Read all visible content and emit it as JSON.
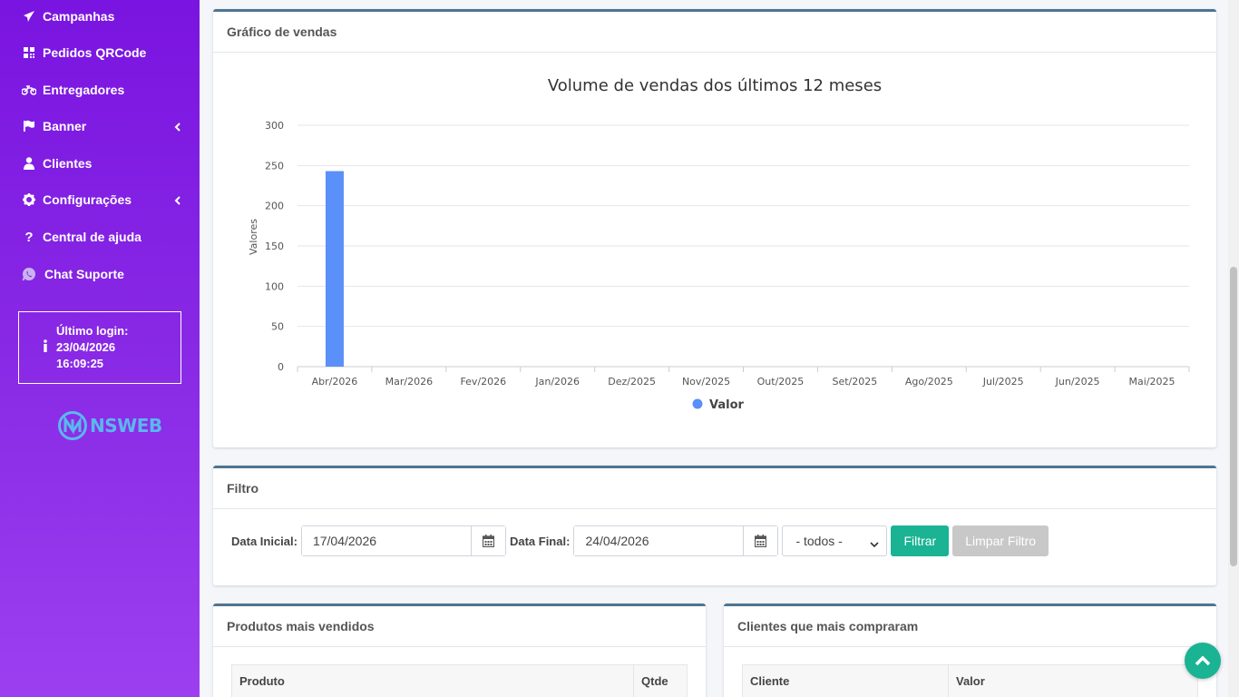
{
  "sidebar": {
    "items": [
      {
        "label": "Campanhas",
        "icon": "paper-plane-icon"
      },
      {
        "label": "Pedidos QRCode",
        "icon": "qrcode-icon"
      },
      {
        "label": "Entregadores",
        "icon": "motorcycle-icon"
      },
      {
        "label": "Banner",
        "icon": "flag-icon"
      },
      {
        "label": "Clientes",
        "icon": "user-icon"
      },
      {
        "label": "Configurações",
        "icon": "gear-icon"
      },
      {
        "label": "Central de ajuda",
        "icon": "question-icon"
      },
      {
        "label": "Chat Suporte",
        "icon": "whatsapp-icon"
      }
    ],
    "login": {
      "label": "Último login:",
      "date": "23/04/2026",
      "time": "16:09:25"
    },
    "logo_text": "NSWEB"
  },
  "sales_card": {
    "title": "Gráfico de vendas"
  },
  "chart_data": {
    "type": "bar",
    "title": "Volume de vendas dos últimos 12 meses",
    "ylabel": "Valores",
    "xlabel": "",
    "categories": [
      "Abr/2026",
      "Mar/2026",
      "Fev/2026",
      "Jan/2026",
      "Dez/2025",
      "Nov/2025",
      "Out/2025",
      "Set/2025",
      "Ago/2025",
      "Jul/2025",
      "Jun/2025",
      "Mai/2025"
    ],
    "series": [
      {
        "name": "Valor",
        "values": [
          243,
          0,
          0,
          0,
          0,
          0,
          0,
          0,
          0,
          0,
          0,
          0
        ],
        "color": "#5b8ff9"
      }
    ],
    "ylim": [
      0,
      300
    ],
    "yticks": [
      0,
      50,
      100,
      150,
      200,
      250,
      300
    ],
    "grid": true,
    "legend": "bottom"
  },
  "filter": {
    "title": "Filtro",
    "start_label": "Data Inicial:",
    "start_value": "17/04/2026",
    "end_label": "Data Final:",
    "end_value": "24/04/2026",
    "select_value": "- todos -",
    "filter_button": "Filtrar",
    "clear_button": "Limpar Filtro"
  },
  "top_products": {
    "title": "Produtos mais vendidos",
    "columns": [
      "Produto",
      "Qtde"
    ]
  },
  "top_customers": {
    "title": "Clientes que mais compraram",
    "columns": [
      "Cliente",
      "Valor"
    ]
  },
  "colors": {
    "accent": "#1ab394",
    "sidebar": "#7a14e0",
    "bar": "#5b8ff9",
    "card_border": "#4f7590"
  }
}
